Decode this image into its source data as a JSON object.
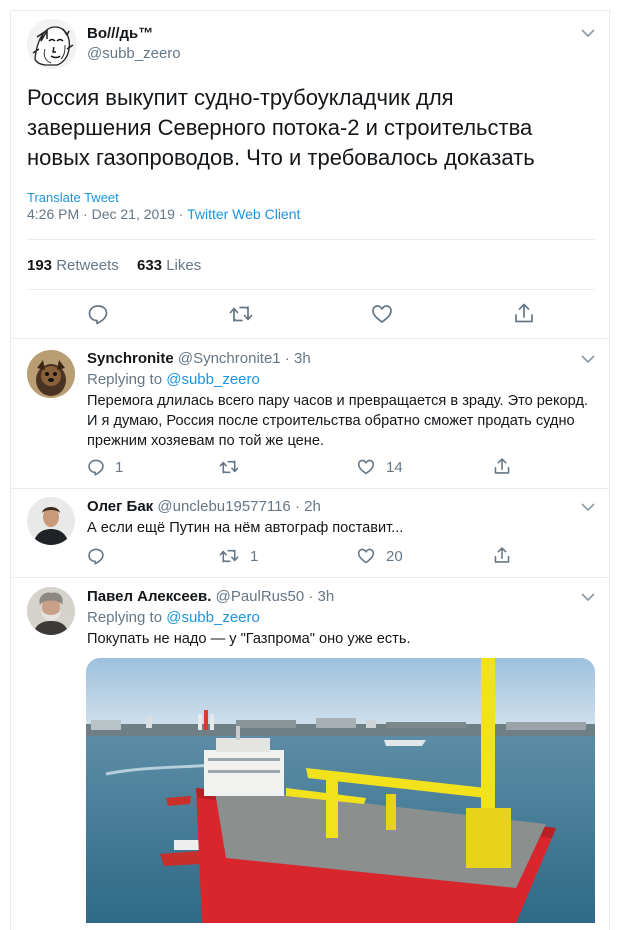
{
  "main_tweet": {
    "author_name": "Bo///дь™",
    "handle": "@subb_zeero",
    "text_lines": [
      "Россия выкупит судно-трубоукладчик для",
      "завершения Северного потока-2 и строительства",
      "новых газопроводов. Что и требовалось доказать"
    ],
    "translate": "Translate Tweet",
    "time": "4:26 PM · Dec 21, 2019 · ",
    "client": "Twitter Web Client",
    "retweets_count": "193",
    "retweets_label": "Retweets",
    "likes_count": "633",
    "likes_label": "Likes"
  },
  "replies": [
    {
      "name": "Synchronite",
      "meta": "@Synchronite1 · 3h",
      "replying_prefix": "Replying to",
      "replying_to": "@subb_zeero",
      "text_lines": [
        "Перемога длилась всего пару часов и превращается в зраду. Это рекорд.",
        "И я думаю, Россия после строительства обратно сможет продать судно",
        "прежним хозяевам по той же цене."
      ],
      "reply_count": "1",
      "retweet_count": "",
      "like_count": "14"
    },
    {
      "name": "Олег Бак",
      "meta": "@unclebu19577116 · 2h",
      "text_lines": [
        "А если ещё Путин на нём автограф поставит..."
      ],
      "reply_count": "",
      "retweet_count": "1",
      "like_count": "20"
    },
    {
      "name": "Павел Алексеев.",
      "meta": "@PaulRus50 · 3h",
      "replying_prefix": "Replying to",
      "replying_to": "@subb_zeero",
      "text_lines": [
        "Покупать не надо — у \"Газпрома\" оно уже есть."
      ]
    }
  ],
  "colors": {
    "link_blue": "#1b95e0",
    "muted_gray": "#657786",
    "ship_red": "#d8262c",
    "crane_yellow": "#f2e21c"
  }
}
